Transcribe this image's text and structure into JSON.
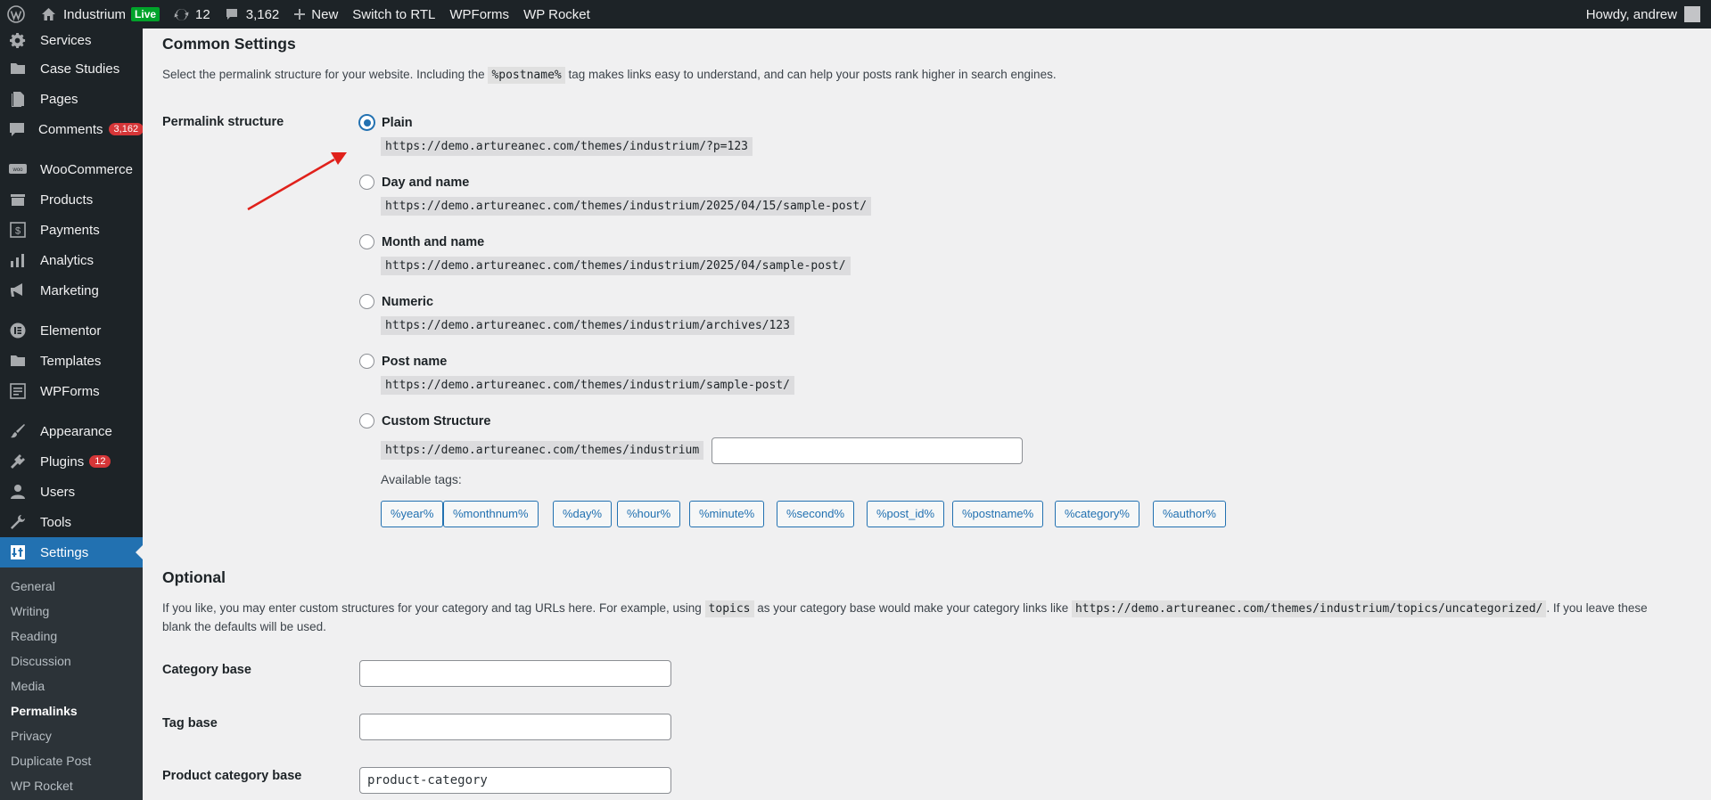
{
  "adminbar": {
    "site_name": "Industrium",
    "live_label": "Live",
    "updates_count": "12",
    "comments_count": "3,162",
    "new_label": "New",
    "rtl_label": "Switch to RTL",
    "wpforms_label": "WPForms",
    "wprocket_label": "WP Rocket",
    "howdy": "Howdy, andrew"
  },
  "sidebar": {
    "items": [
      {
        "label": "Services",
        "icon": "gear-icon"
      },
      {
        "label": "Case Studies",
        "icon": "folder-icon"
      },
      {
        "label": "Pages",
        "icon": "pages-icon"
      },
      {
        "label": "Comments",
        "icon": "comment-icon",
        "badge": "3,162"
      },
      {
        "label": "WooCommerce",
        "icon": "woo-icon"
      },
      {
        "label": "Products",
        "icon": "products-icon"
      },
      {
        "label": "Payments",
        "icon": "payments-icon"
      },
      {
        "label": "Analytics",
        "icon": "analytics-icon"
      },
      {
        "label": "Marketing",
        "icon": "megaphone-icon"
      },
      {
        "label": "Elementor",
        "icon": "elementor-icon"
      },
      {
        "label": "Templates",
        "icon": "folder-icon"
      },
      {
        "label": "WPForms",
        "icon": "forms-icon"
      },
      {
        "label": "Appearance",
        "icon": "brush-icon"
      },
      {
        "label": "Plugins",
        "icon": "plugin-icon",
        "badge": "12"
      },
      {
        "label": "Users",
        "icon": "user-icon"
      },
      {
        "label": "Tools",
        "icon": "wrench-icon"
      },
      {
        "label": "Settings",
        "icon": "settings-icon"
      }
    ],
    "submenu": [
      "General",
      "Writing",
      "Reading",
      "Discussion",
      "Media",
      "Permalinks",
      "Privacy",
      "Duplicate Post",
      "WP Rocket"
    ]
  },
  "common": {
    "title": "Common Settings",
    "desc_before": "Select the permalink structure for your website. Including the",
    "desc_code": "%postname%",
    "desc_after": "tag makes links easy to understand, and can help your posts rank higher in search engines.",
    "row_label": "Permalink structure",
    "options": [
      {
        "label": "Plain",
        "url": "https://demo.artureanec.com/themes/industrium/?p=123",
        "checked": true
      },
      {
        "label": "Day and name",
        "url": "https://demo.artureanec.com/themes/industrium/2025/04/15/sample-post/",
        "checked": false
      },
      {
        "label": "Month and name",
        "url": "https://demo.artureanec.com/themes/industrium/2025/04/sample-post/",
        "checked": false
      },
      {
        "label": "Numeric",
        "url": "https://demo.artureanec.com/themes/industrium/archives/123",
        "checked": false
      },
      {
        "label": "Post name",
        "url": "https://demo.artureanec.com/themes/industrium/sample-post/",
        "checked": false
      },
      {
        "label": "Custom Structure",
        "url": "https://demo.artureanec.com/themes/industrium",
        "checked": false
      }
    ],
    "custom_value": "",
    "available_tags_label": "Available tags:",
    "tags": [
      "%year%",
      "%monthnum%",
      "%day%",
      "%hour%",
      "%minute%",
      "%second%",
      "%post_id%",
      "%postname%",
      "%category%",
      "%author%"
    ]
  },
  "optional": {
    "title": "Optional",
    "desc_1": "If you like, you may enter custom structures for your category and tag URLs here. For example, using",
    "desc_code_1": "topics",
    "desc_2": "as your category base would make your category links like",
    "desc_code_2": "https://demo.artureanec.com/themes/industrium/topics/uncategorized/",
    "desc_3": ". If you leave these",
    "desc_4": "blank the defaults will be used.",
    "category_base_label": "Category base",
    "category_base_value": "",
    "tag_base_label": "Tag base",
    "tag_base_value": "",
    "product_category_base_label": "Product category base",
    "product_category_base_value": "product-category"
  },
  "colors": {
    "admin_dark": "#1d2327",
    "accent": "#2271b1",
    "badge_red": "#d63638",
    "live_green": "#00a32a",
    "arrow_red": "#e0211b"
  }
}
